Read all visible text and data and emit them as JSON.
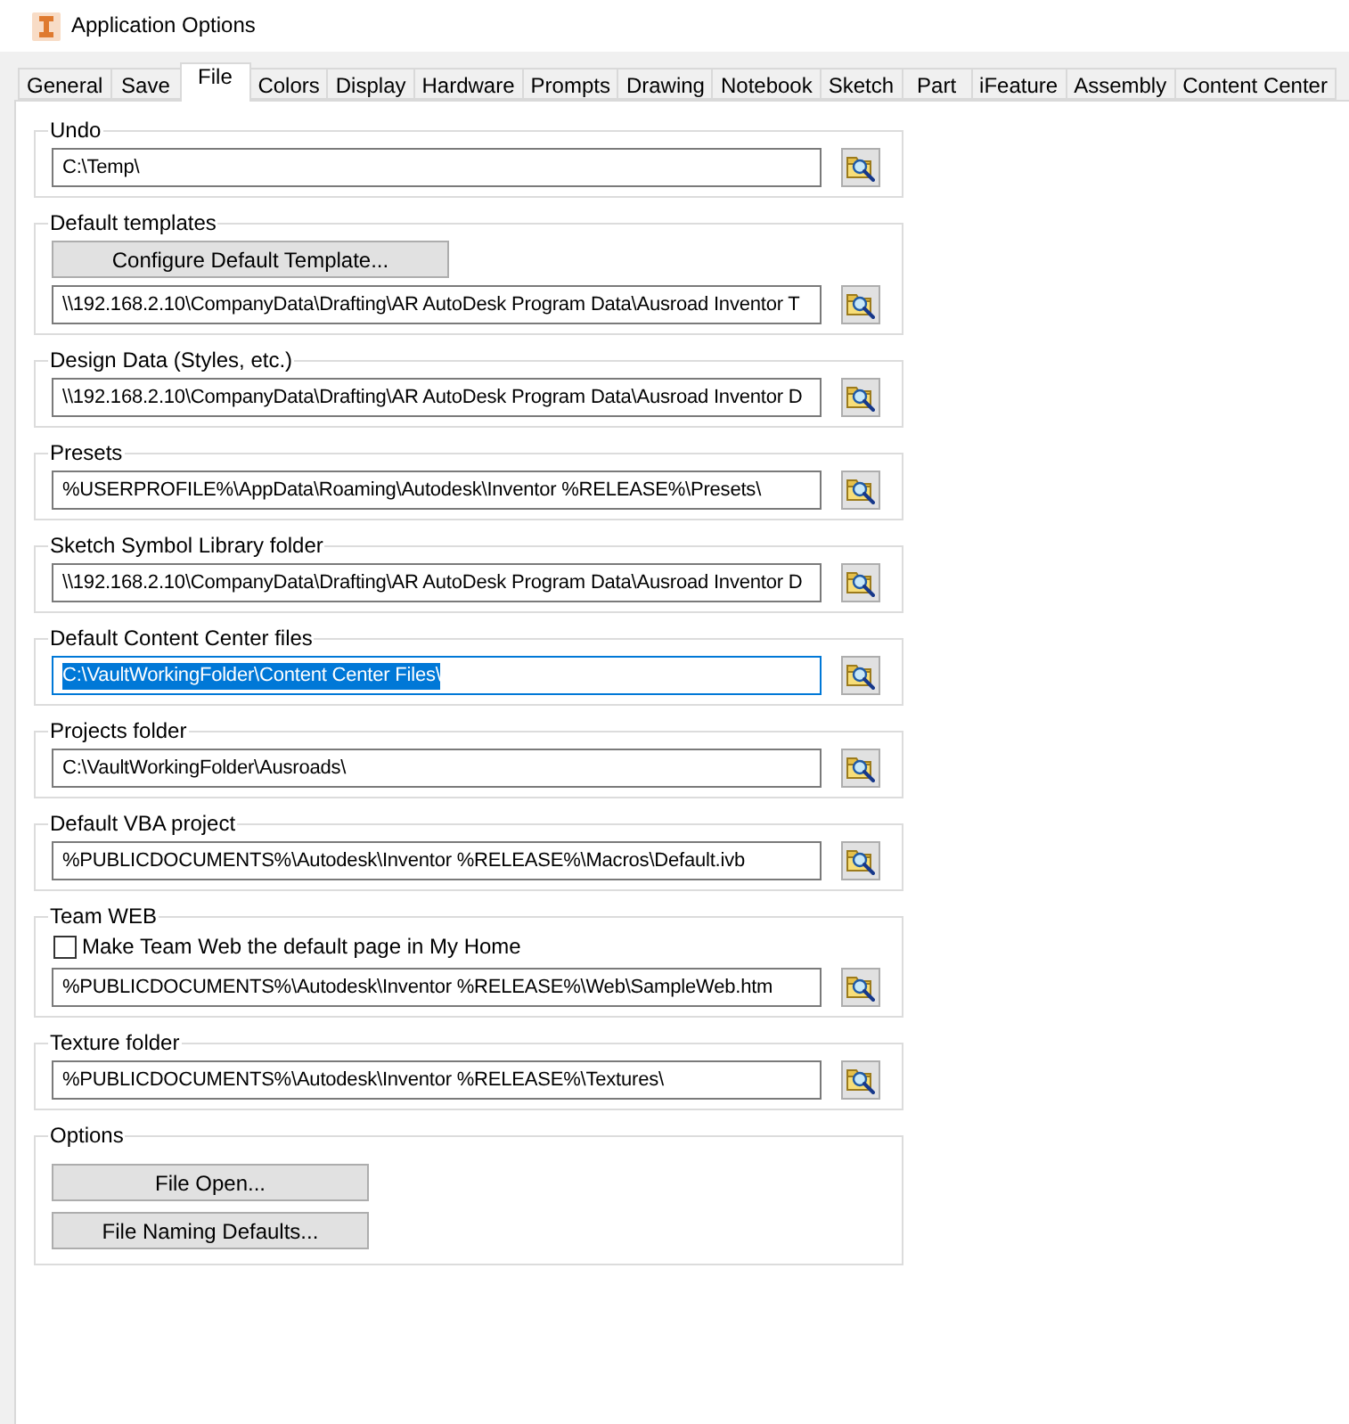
{
  "window": {
    "title": "Application Options"
  },
  "tabs": [
    {
      "label": "General",
      "selected": false
    },
    {
      "label": "Save",
      "selected": false
    },
    {
      "label": "File",
      "selected": true
    },
    {
      "label": "Colors",
      "selected": false
    },
    {
      "label": "Display",
      "selected": false
    },
    {
      "label": "Hardware",
      "selected": false
    },
    {
      "label": "Prompts",
      "selected": false
    },
    {
      "label": "Drawing",
      "selected": false
    },
    {
      "label": "Notebook",
      "selected": false
    },
    {
      "label": "Sketch",
      "selected": false
    },
    {
      "label": "Part",
      "selected": false
    },
    {
      "label": "iFeature",
      "selected": false
    },
    {
      "label": "Assembly",
      "selected": false
    },
    {
      "label": "Content Center",
      "selected": false
    }
  ],
  "groups": [
    {
      "title": "Undo",
      "rows": [
        {
          "kind": "path",
          "value": "C:\\Temp\\",
          "focused": false
        }
      ]
    },
    {
      "title": "Default templates",
      "rows": [
        {
          "kind": "button",
          "label": "Configure Default Template..."
        },
        {
          "kind": "path",
          "value": "\\\\192.168.2.10\\CompanyData\\Drafting\\AR AutoDesk Program Data\\Ausroad Inventor T",
          "focused": false
        }
      ]
    },
    {
      "title": "Design Data (Styles, etc.)",
      "rows": [
        {
          "kind": "path",
          "value": "\\\\192.168.2.10\\CompanyData\\Drafting\\AR AutoDesk Program Data\\Ausroad Inventor D",
          "focused": false
        }
      ]
    },
    {
      "title": "Presets",
      "rows": [
        {
          "kind": "path",
          "value": "%USERPROFILE%\\AppData\\Roaming\\Autodesk\\Inventor %RELEASE%\\Presets\\",
          "focused": false
        }
      ]
    },
    {
      "title": "Sketch Symbol Library folder",
      "rows": [
        {
          "kind": "path",
          "value": "\\\\192.168.2.10\\CompanyData\\Drafting\\AR AutoDesk Program Data\\Ausroad Inventor D",
          "focused": false
        }
      ]
    },
    {
      "title": "Default Content Center files",
      "rows": [
        {
          "kind": "path",
          "value": "C:\\VaultWorkingFolder\\Content Center Files\\",
          "focused": true
        }
      ]
    },
    {
      "title": "Projects folder",
      "rows": [
        {
          "kind": "path",
          "value": "C:\\VaultWorkingFolder\\Ausroads\\",
          "focused": false
        }
      ]
    },
    {
      "title": "Default VBA project",
      "rows": [
        {
          "kind": "path",
          "value": "%PUBLICDOCUMENTS%\\Autodesk\\Inventor %RELEASE%\\Macros\\Default.ivb",
          "focused": false
        }
      ]
    },
    {
      "title": "Team WEB",
      "rows": [
        {
          "kind": "checkbox",
          "label": "Make Team Web the default page in My Home",
          "checked": false
        },
        {
          "kind": "path",
          "value": "%PUBLICDOCUMENTS%\\Autodesk\\Inventor %RELEASE%\\Web\\SampleWeb.htm",
          "focused": false
        }
      ]
    },
    {
      "title": "Texture folder",
      "rows": [
        {
          "kind": "path",
          "value": "%PUBLICDOCUMENTS%\\Autodesk\\Inventor %RELEASE%\\Textures\\",
          "focused": false
        }
      ]
    },
    {
      "title": "Options",
      "rows": [
        {
          "kind": "button",
          "label": "File Open..."
        },
        {
          "kind": "button",
          "label": "File Naming Defaults..."
        }
      ]
    }
  ]
}
